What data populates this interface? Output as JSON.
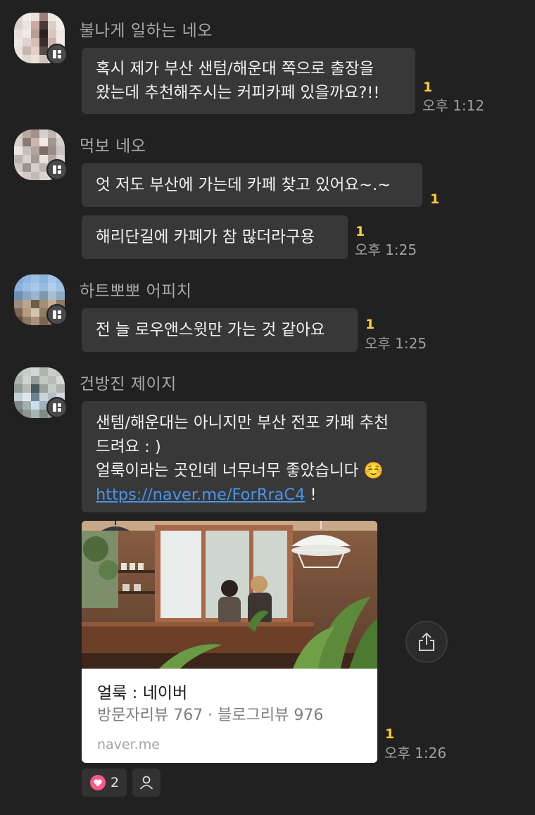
{
  "messages": [
    {
      "sender": "불나게 일하는 네오",
      "bubbles": [
        {
          "lines": [
            "혹시 제가 부산 샌텀/해운대 쪽으로 출장을",
            "왔는데 추천해주시는 커피카페 있을까요?!!"
          ],
          "unread": "1",
          "time": "오후 1:12"
        }
      ]
    },
    {
      "sender": "먹보 네오",
      "bubbles": [
        {
          "lines": [
            "엇 저도 부산에 가는데 카페 찾고 있어요~.~"
          ],
          "unread": "1",
          "time": ""
        },
        {
          "lines": [
            "해리단길에 카페가 참 많더라구용"
          ],
          "unread": "1",
          "time": "오후 1:25"
        }
      ]
    },
    {
      "sender": "하트뽀뽀 어피치",
      "bubbles": [
        {
          "lines": [
            "전 늘 로우앤스윗만 가는 것 같아요"
          ],
          "unread": "1",
          "time": "오후 1:25"
        }
      ]
    },
    {
      "sender": "건방진 제이지",
      "bubbles": [
        {
          "lines": [
            "샌템/해운대는 아니지만 부산 전포 카페 추천",
            "드려요 : )",
            "얼룩이라는 곳인데 너무너무 좋았습니다 ☺️"
          ],
          "link": "https://naver.me/ForRraC4",
          "link_suffix": " !",
          "unread": "",
          "time": ""
        }
      ]
    }
  ],
  "link_card": {
    "title": "얼룩 : 네이버",
    "description": "방문자리뷰 767 · 블로그리뷰 976",
    "domain": "naver.me",
    "unread": "1",
    "time": "오후 1:26"
  },
  "reactions": {
    "heart_count": "2"
  },
  "colors": {
    "background": "#212121",
    "bubble": "#383838",
    "unread": "#ffcf30",
    "link": "#4a94e8",
    "heart": "#ff5a86"
  },
  "icons": [
    "chat-badge-icon",
    "share-icon",
    "heart-icon",
    "person-icon"
  ]
}
